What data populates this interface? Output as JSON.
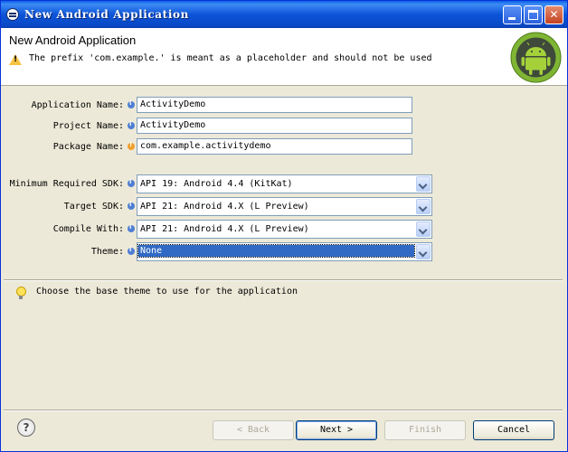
{
  "window": {
    "title": "New Android Application"
  },
  "header": {
    "title": "New Android Application",
    "message": "The prefix 'com.example.' is meant as a placeholder and should not be used"
  },
  "form": {
    "app_name": {
      "label": "Application Name:",
      "value": "ActivityDemo"
    },
    "project_name": {
      "label": "Project Name:",
      "value": "ActivityDemo"
    },
    "package_name": {
      "label": "Package Name:",
      "value": "com.example.activitydemo"
    },
    "min_sdk": {
      "label": "Minimum Required SDK:",
      "value": "API 19: Android 4.4 (KitKat)"
    },
    "target_sdk": {
      "label": "Target SDK:",
      "value": "API 21: Android 4.X (L Preview)"
    },
    "compile_with": {
      "label": "Compile With:",
      "value": "API 21: Android 4.X (L Preview)"
    },
    "theme": {
      "label": "Theme:",
      "value": "None"
    }
  },
  "hint": "Choose the base theme to use for the application",
  "buttons": {
    "back": {
      "label": "< Back",
      "mnemonic": "B",
      "enabled": false
    },
    "next": {
      "label": "Next >",
      "mnemonic": "N",
      "enabled": true
    },
    "finish": {
      "label": "Finish",
      "mnemonic": "F",
      "enabled": false
    },
    "cancel": {
      "label": "Cancel",
      "enabled": true
    },
    "help": "?"
  },
  "colors": {
    "titlebar": "#0a49c8",
    "selection": "#316ac5",
    "dialog_bg": "#ece9d8"
  }
}
